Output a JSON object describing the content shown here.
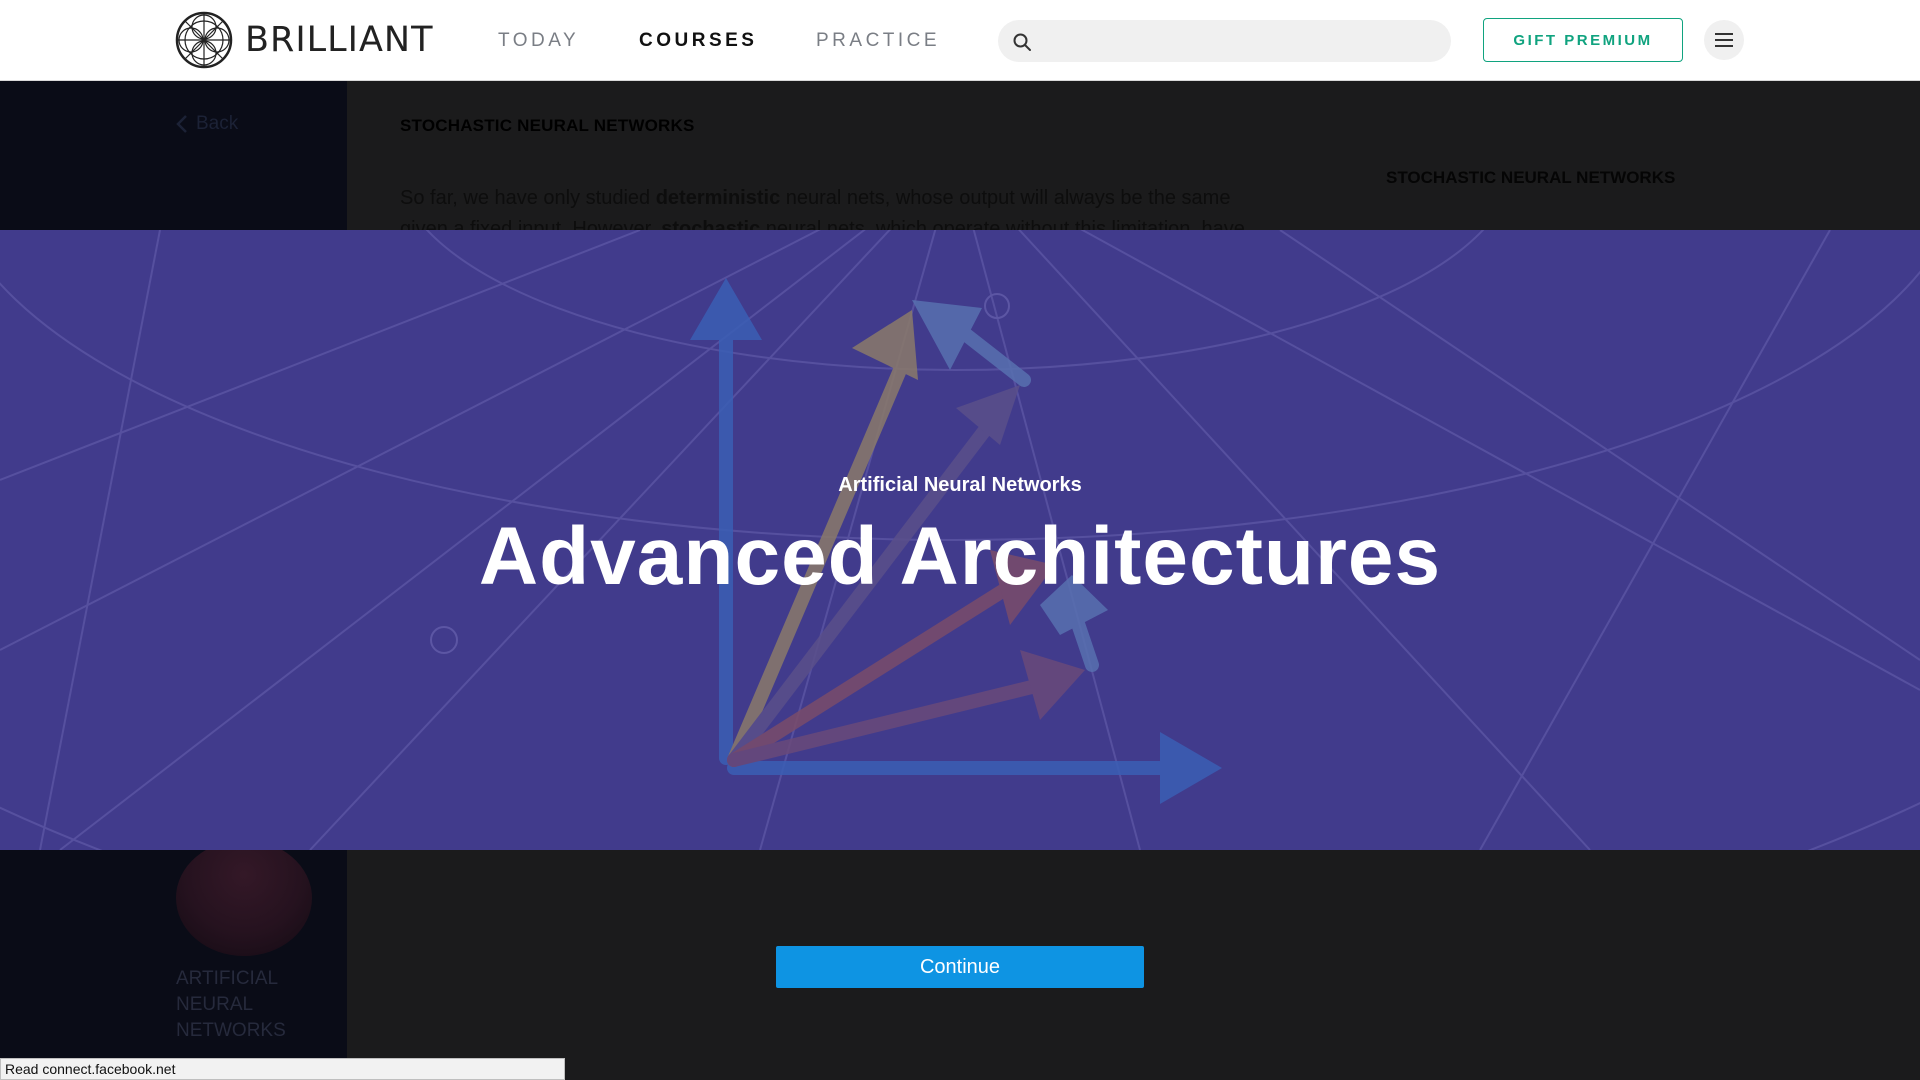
{
  "header": {
    "logo_text": "BRILLIANT",
    "nav": [
      {
        "label": "TODAY"
      },
      {
        "label": "COURSES",
        "active": true
      },
      {
        "label": "PRACTICE"
      }
    ],
    "search": {
      "placeholder": "",
      "value": ""
    },
    "gift_label": "GIFT PREMIUM"
  },
  "sidebar": {
    "back_label": "Back",
    "course_name": "ARTIFICIAL NEURAL NETWORKS"
  },
  "main": {
    "title": "STOCHASTIC NEURAL NETWORKS",
    "para_1": "So far, we have only studied ",
    "para_bold_1": "deterministic",
    "para_2": " neural nets, whose output will always be the same given a fixed input. However, ",
    "para_bold_2": "stochastic",
    "para_3": " neural nets, which operate without this limitation, have",
    "right_title": "STOCHASTIC NEURAL NETWORKS"
  },
  "banner": {
    "subtitle": "Artificial Neural Networks",
    "title": "Advanced Architectures",
    "bg_color": "#413b8c"
  },
  "continue_label": "Continue",
  "status_text": "Read connect.facebook.net",
  "colors": {
    "accent_green": "#10a37f",
    "continue_blue": "#0e94e3"
  }
}
